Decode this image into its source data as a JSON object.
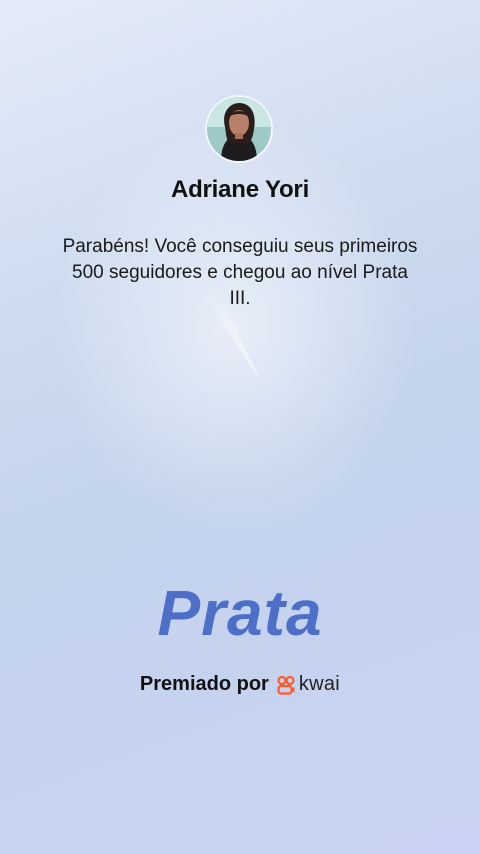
{
  "profile": {
    "name": "Adriane Yori"
  },
  "message": {
    "text": "Parabéns! Você conseguiu seus primeiros 500 seguidores e chegou ao nível Prata III."
  },
  "level": {
    "label": "Prata"
  },
  "footer": {
    "awarded_by": "Premiado por",
    "brand": "kwai",
    "brand_icon": "kwai-logo-icon",
    "brand_color": "#ff5a2c"
  },
  "colors": {
    "level_text": "#4d6fc8"
  }
}
